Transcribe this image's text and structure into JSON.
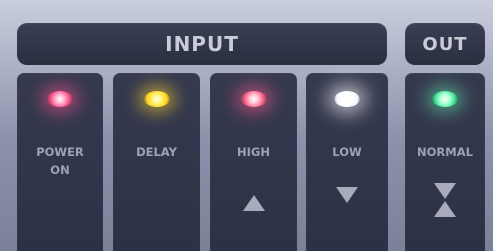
{
  "panel": {
    "input_header": "INPUT",
    "out_header": "OUT",
    "indicators": [
      {
        "label": "POWER\nON",
        "led_color": "#ff5f8a"
      },
      {
        "label": "DELAY",
        "led_color": "#ffe23a"
      },
      {
        "label": "HIGH",
        "led_color": "#ff6f8e"
      },
      {
        "label": "LOW",
        "led_color": "#ffffff"
      },
      {
        "label": "NORMAL",
        "led_color": "#7dffc4"
      }
    ]
  },
  "icons": {
    "high_arrow": "up-arrow-icon",
    "low_arrow": "down-arrow-icon",
    "normal_arrows": "up-down-arrow-icon"
  }
}
